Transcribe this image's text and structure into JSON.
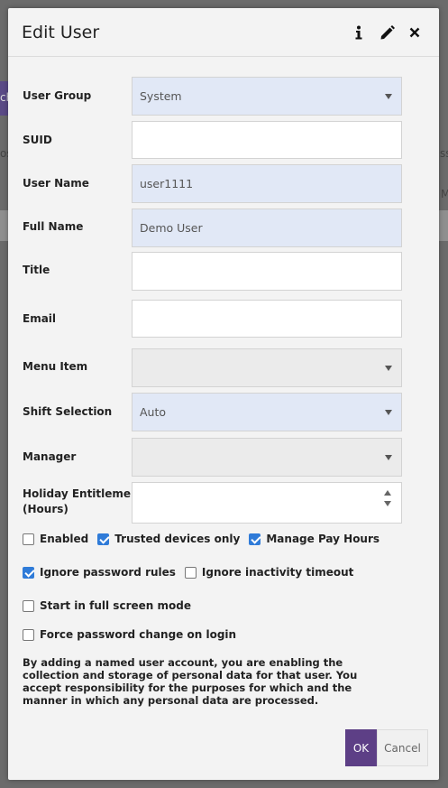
{
  "background": {
    "frag_left_top": "ch",
    "frag_left_mid": "os",
    "frag_right_mid": "ss",
    "frag_right_low": "M"
  },
  "dialog": {
    "title": "Edit User",
    "info_icon": "info-icon",
    "edit_icon": "pencil-icon",
    "close_icon": "close-icon"
  },
  "fields": {
    "user_group": {
      "label": "User Group",
      "value": "System"
    },
    "suid": {
      "label": "SUID",
      "value": ""
    },
    "user_name": {
      "label": "User Name",
      "value": "user1111"
    },
    "full_name": {
      "label": "Full Name",
      "value": "Demo User"
    },
    "title": {
      "label": "Title",
      "value": ""
    },
    "email": {
      "label": "Email",
      "value": ""
    },
    "menu_item": {
      "label": "Menu Item",
      "value": ""
    },
    "shift_selection": {
      "label": "Shift Selection",
      "value": "Auto"
    },
    "manager": {
      "label": "Manager",
      "value": ""
    },
    "holiday": {
      "label_line1": "Holiday Entitlement",
      "label_line2": "(Hours)",
      "value": ""
    }
  },
  "checkboxes": {
    "enabled": {
      "label": "Enabled",
      "checked": false
    },
    "trusted_devices": {
      "label": "Trusted devices only",
      "checked": true
    },
    "manage_pay_hours": {
      "label": "Manage Pay Hours",
      "checked": true
    },
    "ignore_password_rules": {
      "label": "Ignore password rules",
      "checked": true
    },
    "ignore_inactivity": {
      "label": "Ignore inactivity timeout",
      "checked": false
    },
    "full_screen": {
      "label": "Start in full screen mode",
      "checked": false
    },
    "force_password_change": {
      "label": "Force password change on login",
      "checked": false
    }
  },
  "notice": "By adding a named user account, you are enabling the collection and storage of personal data for that user.  You accept responsibility for the purposes for which and the manner in which any personal data are processed.",
  "buttons": {
    "ok": "OK",
    "cancel": "Cancel"
  },
  "colors": {
    "primary": "#5d3f86",
    "field_highlight": "#e1e8f6",
    "checkbox_checked": "#2f7bd8"
  }
}
